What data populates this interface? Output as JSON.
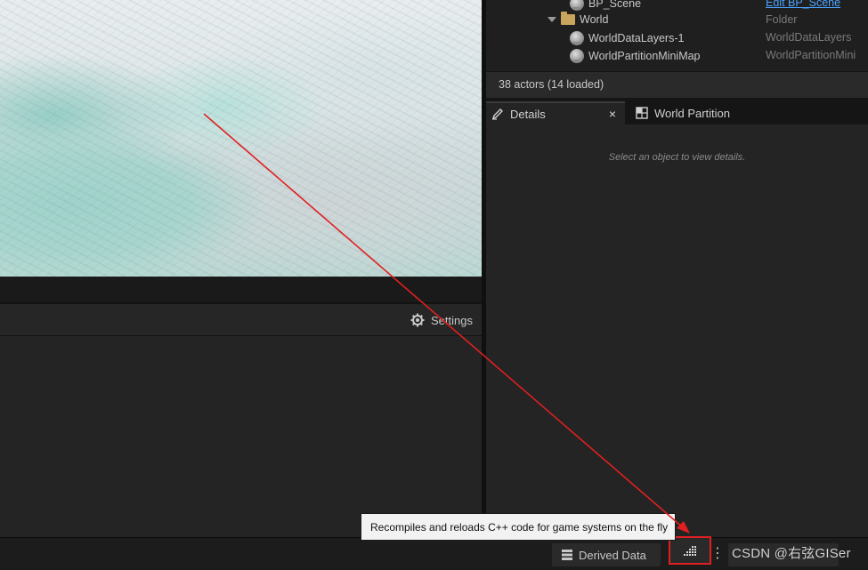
{
  "outliner": {
    "rows": [
      {
        "name": "BP_Scene",
        "type": "Edit BP_Scene"
      },
      {
        "name": "World",
        "type": "Folder"
      },
      {
        "name": "WorldDataLayers-1",
        "type": "WorldDataLayers"
      },
      {
        "name": "WorldPartitionMiniMap",
        "type": "WorldPartitionMini"
      }
    ],
    "actor_count": "38 actors (14 loaded)"
  },
  "details": {
    "tabs": [
      {
        "label": "Details",
        "close": "×"
      },
      {
        "label": "World Partition"
      }
    ],
    "empty_hint": "Select an object to view details."
  },
  "lower_panel": {
    "settings_label": "Settings"
  },
  "statusbar": {
    "derived_data_label": "Derived Data",
    "more_menu": "⋮"
  },
  "tooltip": {
    "text": "Recompiles and reloads C++ code for game systems on the fly"
  },
  "watermark": {
    "text": "CSDN @右弦GISer"
  },
  "colors": {
    "annotation_red": "#e02020",
    "link_blue": "#4aa3ff",
    "folder_gold": "#c9a45c"
  },
  "icons": [
    "settings-icon",
    "actor-icon",
    "folder-icon",
    "details-icon",
    "world-partition-icon",
    "derived-data-icon",
    "live-coding-icon"
  ]
}
